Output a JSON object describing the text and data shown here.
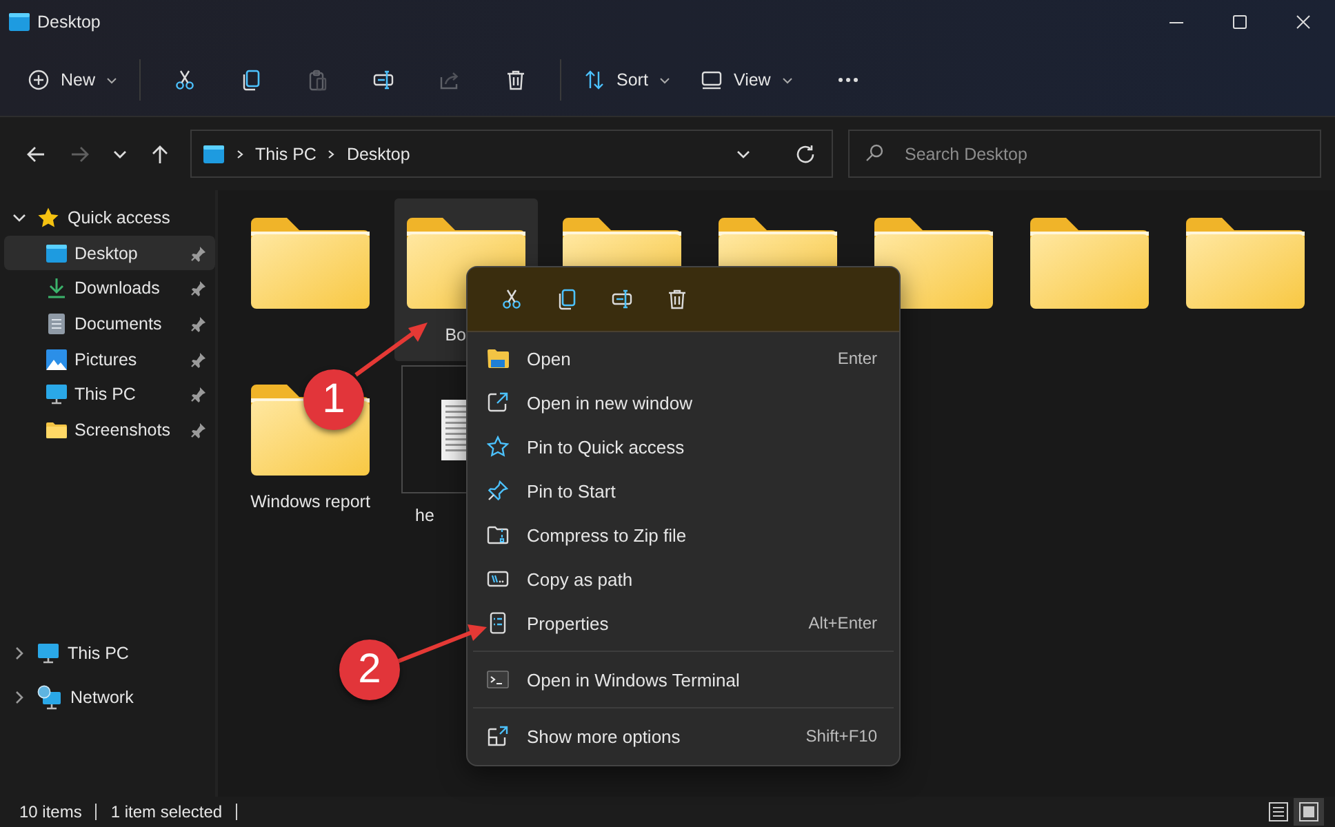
{
  "window": {
    "title": "Desktop"
  },
  "toolbar": [
    {
      "kind": "new",
      "label": "New",
      "disabled": false
    },
    {
      "kind": "cut",
      "disabled": false
    },
    {
      "kind": "copy",
      "disabled": false
    },
    {
      "kind": "paste",
      "disabled": true
    },
    {
      "kind": "rename",
      "disabled": false
    },
    {
      "kind": "share",
      "disabled": true
    },
    {
      "kind": "delete",
      "disabled": false
    },
    {
      "kind": "sort",
      "label": "Sort",
      "disabled": false
    },
    {
      "kind": "view",
      "label": "View",
      "disabled": false
    },
    {
      "kind": "more",
      "disabled": false
    }
  ],
  "navigation": [
    {
      "kind": "back",
      "disabled": false
    },
    {
      "kind": "forward",
      "disabled": true
    },
    {
      "kind": "recent",
      "disabled": false
    },
    {
      "kind": "up",
      "disabled": false
    }
  ],
  "address": {
    "crumbs": [
      "This PC",
      "Desktop"
    ]
  },
  "search": {
    "placeholder": "Search Desktop"
  },
  "sidebar": {
    "items": [
      {
        "kind": "star",
        "label": "Quick access",
        "expanded": true,
        "selected": false,
        "children": [
          {
            "kind": "desktop",
            "label": "Desktop",
            "selected": true,
            "pinned": true
          },
          {
            "kind": "downloads",
            "label": "Downloads",
            "selected": false,
            "pinned": true
          },
          {
            "kind": "documents",
            "label": "Documents",
            "selected": false,
            "pinned": true
          },
          {
            "kind": "pictures",
            "label": "Pictures",
            "selected": false,
            "pinned": true
          },
          {
            "kind": "pc",
            "label": "This PC",
            "selected": false,
            "pinned": true
          },
          {
            "kind": "folder",
            "label": "Screenshots",
            "selected": false,
            "pinned": true
          }
        ]
      },
      {
        "kind": "pc",
        "label": "This PC",
        "expanded": false,
        "selected": false
      },
      {
        "kind": "network",
        "label": "Network",
        "expanded": false,
        "selected": false
      }
    ]
  },
  "files": [
    {
      "kind": "folder",
      "selected": false
    },
    {
      "kind": "folder",
      "label": "Bo",
      "selected": true
    },
    {
      "kind": "folder",
      "selected": false
    },
    {
      "kind": "folder",
      "selected": false
    },
    {
      "kind": "folder",
      "selected": false
    },
    {
      "kind": "folder",
      "selected": false
    },
    {
      "kind": "folder",
      "selected": false
    },
    {
      "kind": "folder",
      "label": "Windows report",
      "selected": false
    },
    {
      "kind": "document",
      "label": "he",
      "selected": false
    }
  ],
  "context_menu": {
    "actions": [
      {
        "kind": "cut"
      },
      {
        "kind": "copy"
      },
      {
        "kind": "rename"
      },
      {
        "kind": "delete"
      }
    ],
    "groups": [
      [
        {
          "kind": "open",
          "label": "Open",
          "shortcut": "Enter"
        },
        {
          "kind": "new-window",
          "label": "Open in new window"
        },
        {
          "kind": "pin-quick",
          "label": "Pin to Quick access"
        },
        {
          "kind": "pin-start",
          "label": "Pin to Start"
        },
        {
          "kind": "zip",
          "label": "Compress to Zip file"
        },
        {
          "kind": "copy-path",
          "label": "Copy as path"
        },
        {
          "kind": "properties",
          "label": "Properties",
          "shortcut": "Alt+Enter"
        }
      ],
      [
        {
          "kind": "terminal",
          "label": "Open in Windows Terminal"
        }
      ],
      [
        {
          "kind": "more-options",
          "label": "Show more options",
          "shortcut": "Shift+F10"
        }
      ]
    ]
  },
  "annotations": [
    {
      "label": "1"
    },
    {
      "label": "2"
    }
  ],
  "status_bar": {
    "texts": [
      "10 items",
      "1 item selected"
    ],
    "view_buttons": [
      {
        "kind": "details",
        "selected": false
      },
      {
        "kind": "tiles",
        "selected": true
      }
    ]
  }
}
